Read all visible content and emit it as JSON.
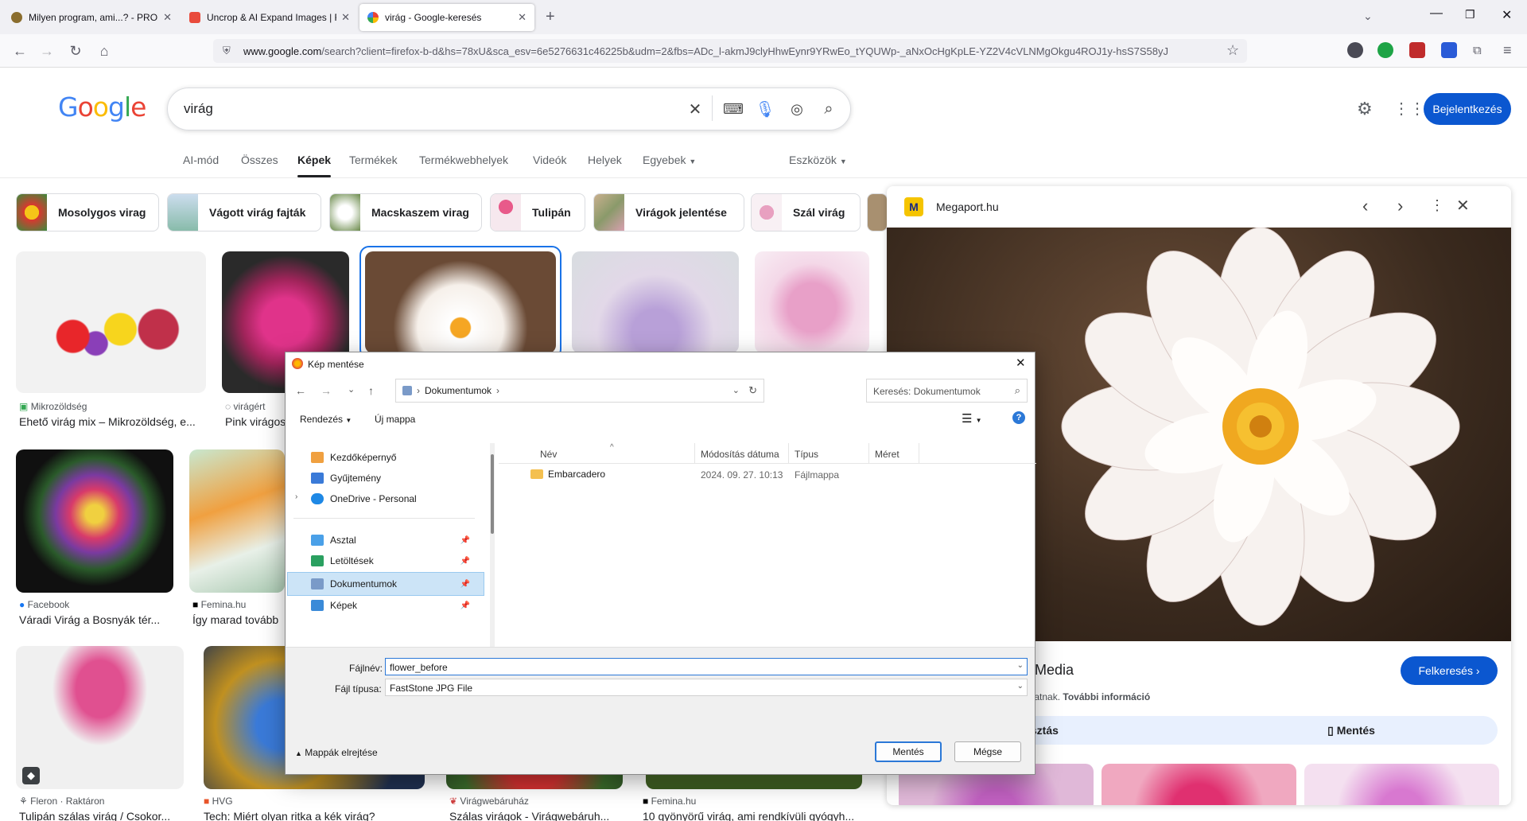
{
  "browser": {
    "tabs": [
      {
        "title": "Milyen program, ami...? - PROHA",
        "active": false
      },
      {
        "title": "Uncrop & AI Expand Images | Fr",
        "active": false
      },
      {
        "title": "virág - Google-keresés",
        "active": true
      }
    ],
    "url_domain": "www.google.com",
    "url_rest": "/search?client=firefox-b-d&hs=78xU&sca_esv=6e5276631c46225b&udm=2&fbs=ADc_l-akmJ9clyHhwEynr9YRwEo_tYQUWp-_aNxOcHgKpLE-YZ2V4cVLNMgOkgu4ROJ1y-hsS7S58yJ"
  },
  "google": {
    "logo": "Google",
    "query": "virág",
    "signin": "Bejelentkezés",
    "filters": [
      "AI-mód",
      "Összes",
      "Képek",
      "Termékek",
      "Termékwebhelyek",
      "Videók",
      "Helyek",
      "Egyebek"
    ],
    "tools": "Eszközök",
    "chips": [
      "Mosolygos virag",
      "Vágott virág fajták",
      "Macskaszem virag",
      "Tulipán",
      "Virágok jelentése",
      "Szál virág"
    ]
  },
  "results": [
    {
      "source": "Mikrozöldség",
      "title": "Ehető virág mix – Mikrozöldség, e..."
    },
    {
      "source": "virágért",
      "title": "Pink virágos"
    },
    {
      "source": "Facebook",
      "title": "Váradi Virág a Bosnyák tér..."
    },
    {
      "source": "Femina.hu",
      "title": "Így marad tovább"
    },
    {
      "source": "Fleron · Raktáron",
      "title": "Tulipán szálas virág / Csokor..."
    },
    {
      "source": "HVG",
      "title": "Tech: Miért olyan ritka a kék virág?"
    },
    {
      "source": "Virágwebáruház",
      "title": "Szálas virágok - Virágwebáruh..."
    },
    {
      "source": "Femina.hu",
      "title": "10 gyönyörű virág, ami rendkívüli gyógyh..."
    }
  ],
  "panel": {
    "site": "Megaport.hu",
    "title_partial": "port Media",
    "visit": "Felkeresés",
    "note_partial": "att állhatnak.",
    "more_info": "További információ",
    "share_partial": "egosztás",
    "save": "Mentés"
  },
  "dialog": {
    "title": "Kép mentése",
    "path": "Dokumentumok",
    "search_placeholder": "Keresés: Dokumentumok",
    "organize": "Rendezés",
    "new_folder": "Új mappa",
    "tree": [
      "Kezdőképernyő",
      "Gyűjtemény",
      "OneDrive - Personal",
      "Asztal",
      "Letöltések",
      "Dokumentumok",
      "Képek"
    ],
    "columns": [
      "Név",
      "Módosítás dátuma",
      "Típus",
      "Méret"
    ],
    "files": [
      {
        "name": "Embarcadero",
        "date": "2024. 09. 27. 10:13",
        "type": "Fájlmappa",
        "size": ""
      }
    ],
    "filename_label": "Fájlnév:",
    "filename": "flower_before",
    "filetype_label": "Fájl típusa:",
    "filetype": "FastStone JPG File",
    "hide_folders": "Mappák elrejtése",
    "save": "Mentés",
    "cancel": "Mégse"
  }
}
